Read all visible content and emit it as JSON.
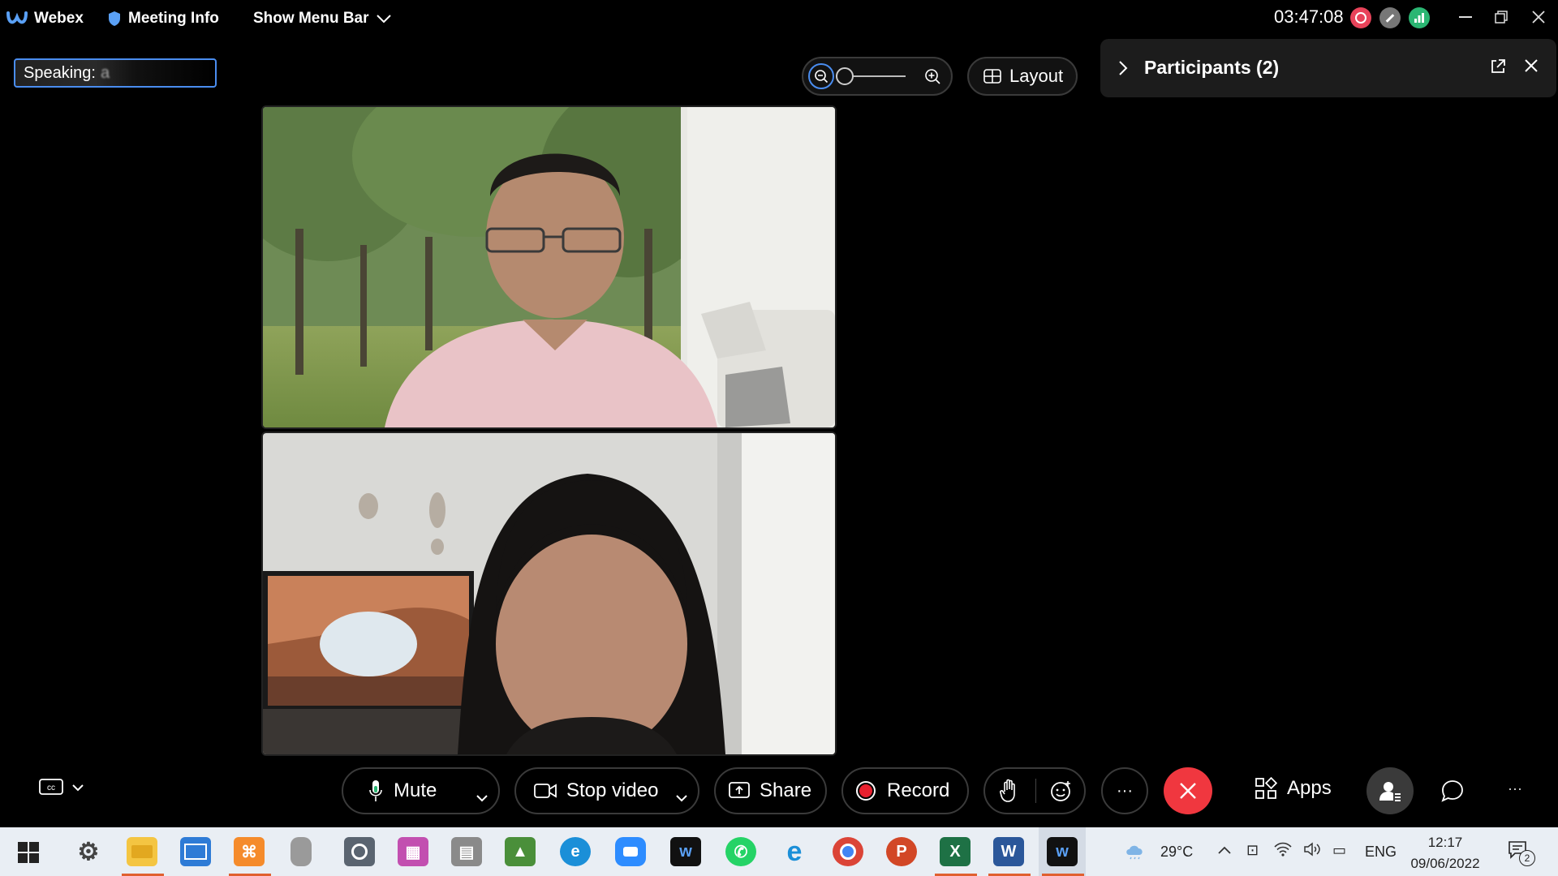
{
  "titlebar": {
    "app_name": "Webex",
    "meeting_info": "Meeting Info",
    "show_menu_bar": "Show Menu Bar",
    "timer": "03:47:08"
  },
  "speaking": {
    "label": "Speaking:",
    "name_partial": "a"
  },
  "layout_button": "Layout",
  "participants": {
    "title": "Participants (2)"
  },
  "controls": {
    "mute": "Mute",
    "stop_video": "Stop video",
    "share": "Share",
    "record": "Record",
    "more": "···",
    "apps": "Apps",
    "overflow": "···"
  },
  "taskbar": {
    "weather": "29°C",
    "language": "ENG",
    "time": "12:17",
    "date": "09/06/2022",
    "notification_count": "2",
    "pinned": [
      "settings",
      "file-explorer",
      "control-panel",
      "xampp",
      "microphone",
      "camera",
      "paint",
      "scanner",
      "photo-viewer",
      "edge",
      "zoom",
      "webex",
      "whatsapp",
      "internet-explorer",
      "chrome",
      "powerpoint",
      "excel",
      "word",
      "webex-active"
    ]
  },
  "colors": {
    "record_red": "#e8202e",
    "end_call_red": "#f0373f",
    "focus_blue": "#4a8df0",
    "webex_accent": "#2bb673"
  }
}
